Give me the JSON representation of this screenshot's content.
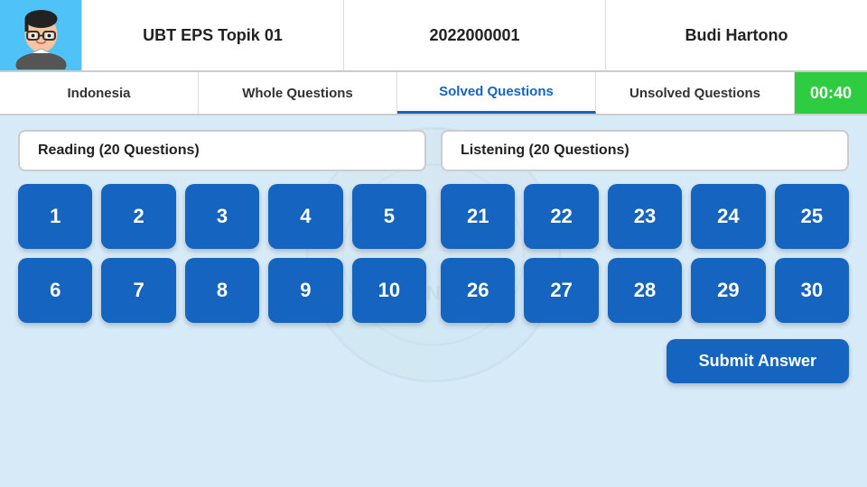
{
  "header": {
    "exam_title": "UBT EPS Topik 01",
    "exam_code": "2022000001",
    "user_name": "Budi Hartono"
  },
  "nav": {
    "tabs": [
      {
        "label": "Indonesia",
        "active": false
      },
      {
        "label": "Whole Questions",
        "active": false
      },
      {
        "label": "Solved Questions",
        "active": true
      },
      {
        "label": "Unsolved Questions",
        "active": false
      },
      {
        "label": "00:40",
        "timer": true
      }
    ]
  },
  "sections": {
    "reading": "Reading (20 Questions)",
    "listening": "Listening (20 Questions)"
  },
  "reading_questions": [
    [
      1,
      2,
      3,
      4,
      5
    ],
    [
      6,
      7,
      8,
      9,
      10
    ]
  ],
  "listening_questions": [
    [
      21,
      22,
      23,
      24,
      25
    ],
    [
      26,
      27,
      28,
      29,
      30
    ]
  ],
  "submit_label": "Submit Answer",
  "watermark_text": "INDONESIA"
}
